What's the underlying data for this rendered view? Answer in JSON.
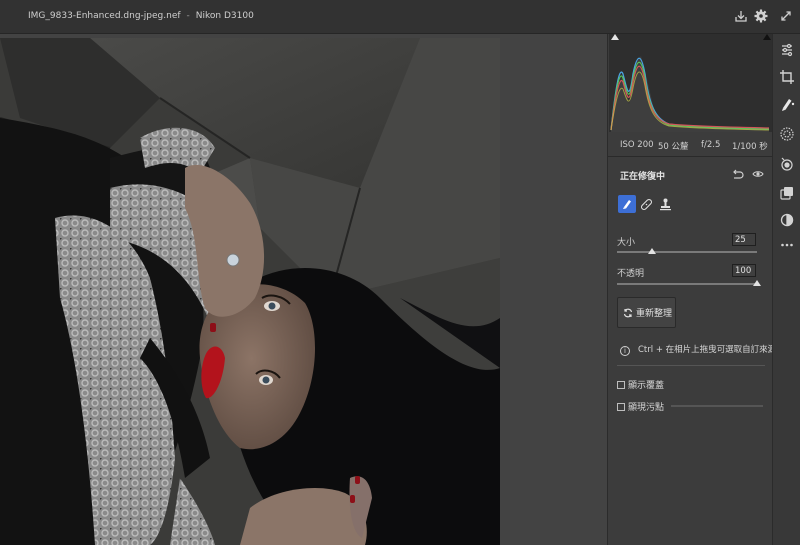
{
  "titlebar": {
    "filename": "IMG_9833-Enhanced.dng-jpeg.nef",
    "separator": "-",
    "camera": "Nikon D3100",
    "icons": [
      "save-icon",
      "gear-icon",
      "expand-icon"
    ]
  },
  "exif": {
    "iso": "ISO 200",
    "focal": "50 公釐",
    "aperture": "f/2.5",
    "shutter": "1/100 秒"
  },
  "panel": {
    "section_title": "正在修復中",
    "tools": [
      "heal-brush-icon",
      "bandage-icon",
      "clone-stamp-icon"
    ],
    "size_label": "大小",
    "size_value": "25",
    "size_fraction": 0.25,
    "opacity_label": "不透明",
    "opacity_value": "100",
    "opacity_fraction": 1.0,
    "reset_label": "重新整理",
    "hint_text": "Ctrl + 在相片上拖曳可選取自訂來源。",
    "show_overlay_label": "顯示覆蓋",
    "visualize_spots_label": "顯現污點"
  },
  "toolrail": [
    "sliders-icon",
    "crop-icon",
    "heal-icon",
    "mask-icon",
    "redeye-icon",
    "presets-icon",
    "snapshot-icon",
    "more-icon"
  ],
  "colors": {
    "accent": "#3d6fd6",
    "panel_bg": "#3c3c3c",
    "titlebar_bg": "#323232",
    "canvas_bg": "#434343"
  }
}
